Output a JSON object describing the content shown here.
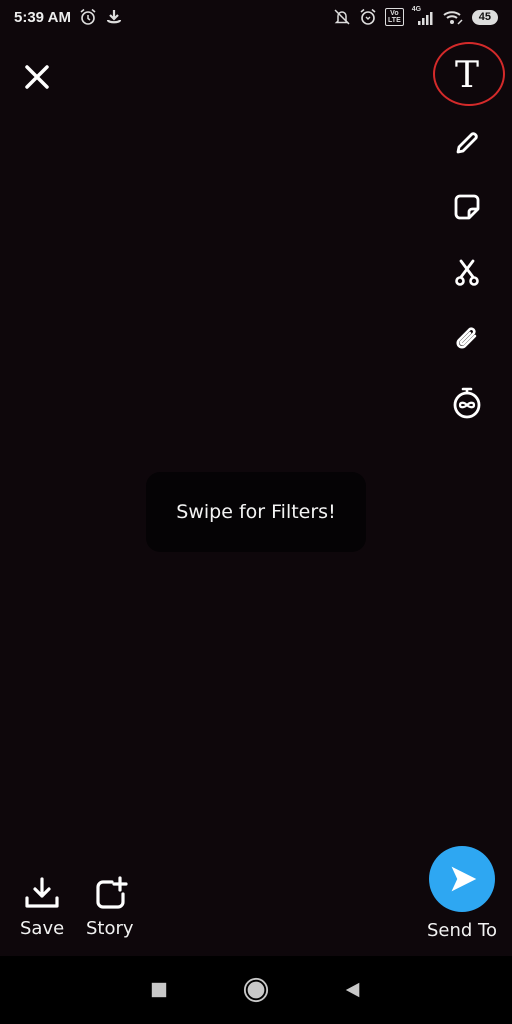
{
  "status_bar": {
    "time": "5:39 AM",
    "left_icons": [
      "alarm-icon",
      "download-icon"
    ],
    "right_icons": [
      "mute-notifications-icon",
      "alarm-icon",
      "volte-icon",
      "signal-4g-icon",
      "wifi-icon",
      "battery-icon"
    ],
    "volte_label_top": "Vo",
    "volte_label_bottom": "LTE",
    "network_type": "4G",
    "battery_level": "45"
  },
  "editor": {
    "close_icon": "close-icon",
    "tools": [
      {
        "name": "text-tool",
        "icon": "text-icon",
        "glyph": "T",
        "highlighted": true
      },
      {
        "name": "draw-tool",
        "icon": "pencil-icon"
      },
      {
        "name": "sticker-tool",
        "icon": "sticker-icon"
      },
      {
        "name": "scissors-tool",
        "icon": "scissors-icon"
      },
      {
        "name": "attachment-tool",
        "icon": "paperclip-icon"
      },
      {
        "name": "timer-tool",
        "icon": "infinity-timer-icon"
      }
    ],
    "highlight_color": "#d42a2a",
    "hint_text": "Swipe for Filters!"
  },
  "bottom_bar": {
    "save_label": "Save",
    "story_label": "Story",
    "send_label": "Send To",
    "send_color": "#2ea7f2"
  },
  "navigation": {
    "buttons": [
      "recents-icon",
      "home-icon",
      "back-icon"
    ]
  }
}
